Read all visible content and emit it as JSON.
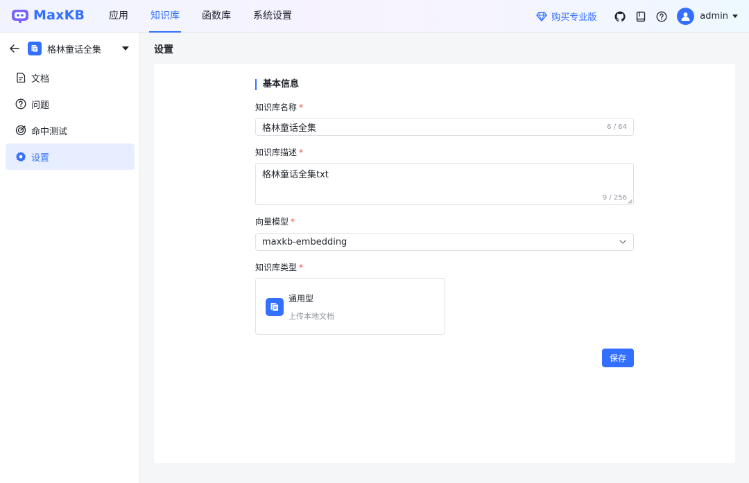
{
  "app": {
    "logo_text": "MaxKB"
  },
  "nav": {
    "items": [
      {
        "label": "应用"
      },
      {
        "label": "知识库"
      },
      {
        "label": "函数库"
      },
      {
        "label": "系统设置"
      }
    ],
    "active": "知识库"
  },
  "header": {
    "buy_label": "购买专业版",
    "icons": [
      "github-icon",
      "document-icon",
      "help-icon"
    ],
    "user": {
      "name": "admin"
    }
  },
  "sidebar": {
    "knowledge_base_name": "格林童话全集",
    "items": [
      {
        "label": "文档",
        "icon": "document-icon"
      },
      {
        "label": "问题",
        "icon": "question-icon"
      },
      {
        "label": "命中测试",
        "icon": "target-icon"
      },
      {
        "label": "设置",
        "icon": "gear-icon",
        "active": true
      }
    ]
  },
  "page": {
    "title": "设置"
  },
  "form": {
    "section_title": "基本信息",
    "name": {
      "label": "知识库名称",
      "required_mark": "*",
      "value": "格林童话全集",
      "counter": "6 / 64"
    },
    "description": {
      "label": "知识库描述",
      "required_mark": "*",
      "value": "格林童话全集txt",
      "counter": "9 / 256"
    },
    "model": {
      "label": "向量模型",
      "required_mark": "*",
      "value": "maxkb-embedding"
    },
    "type": {
      "label": "知识库类型",
      "required_mark": "*",
      "option_name": "通用型",
      "option_desc": "上传本地文档"
    },
    "save_label": "保存"
  },
  "colors": {
    "accent": "#3370ff",
    "required": "#f54a45",
    "active_bg": "#e6eeff"
  }
}
